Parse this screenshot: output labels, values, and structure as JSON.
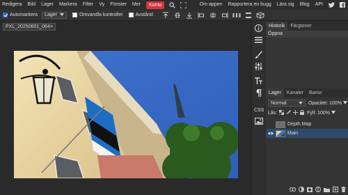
{
  "menubar": {
    "items": [
      "Redigera",
      "Bild",
      "Lager",
      "Markera",
      "Filter",
      "Vy",
      "Fönster",
      "Mer"
    ],
    "active_item": "Konto",
    "right_items": [
      "Om appen",
      "Rapportera en bugg",
      "Lära sig",
      "Blog",
      "API"
    ],
    "accent_color": "#d8333a"
  },
  "options": {
    "auto_select_label": "Automarkera",
    "auto_select_checked": true,
    "layer_select_value": "Lager",
    "transform_controls_label": "Omvandla kontroller",
    "transform_controls_checked": false,
    "distance_label": "Avstånd",
    "distance_checked": false
  },
  "document": {
    "tab_title": "PXL_20250601_064",
    "close_glyph": "×"
  },
  "panel": {
    "history_tabs": [
      "Historik",
      "Färgtoner"
    ],
    "history_items": [
      "Öppna"
    ],
    "layer_tabs": [
      "Lager",
      "Kanaler",
      "Banor"
    ],
    "blend_mode": "Normal",
    "opacity_label": "Opacitet:",
    "opacity_value": "100%",
    "lock_label": "Lås:",
    "fill_label": "Fyll:",
    "fill_value": "100%",
    "layers": [
      {
        "name": "Depth Map",
        "visible": false,
        "selected": false
      },
      {
        "name": "Main",
        "visible": true,
        "selected": true
      }
    ],
    "selected_layer_color": "#2c4a6e"
  }
}
